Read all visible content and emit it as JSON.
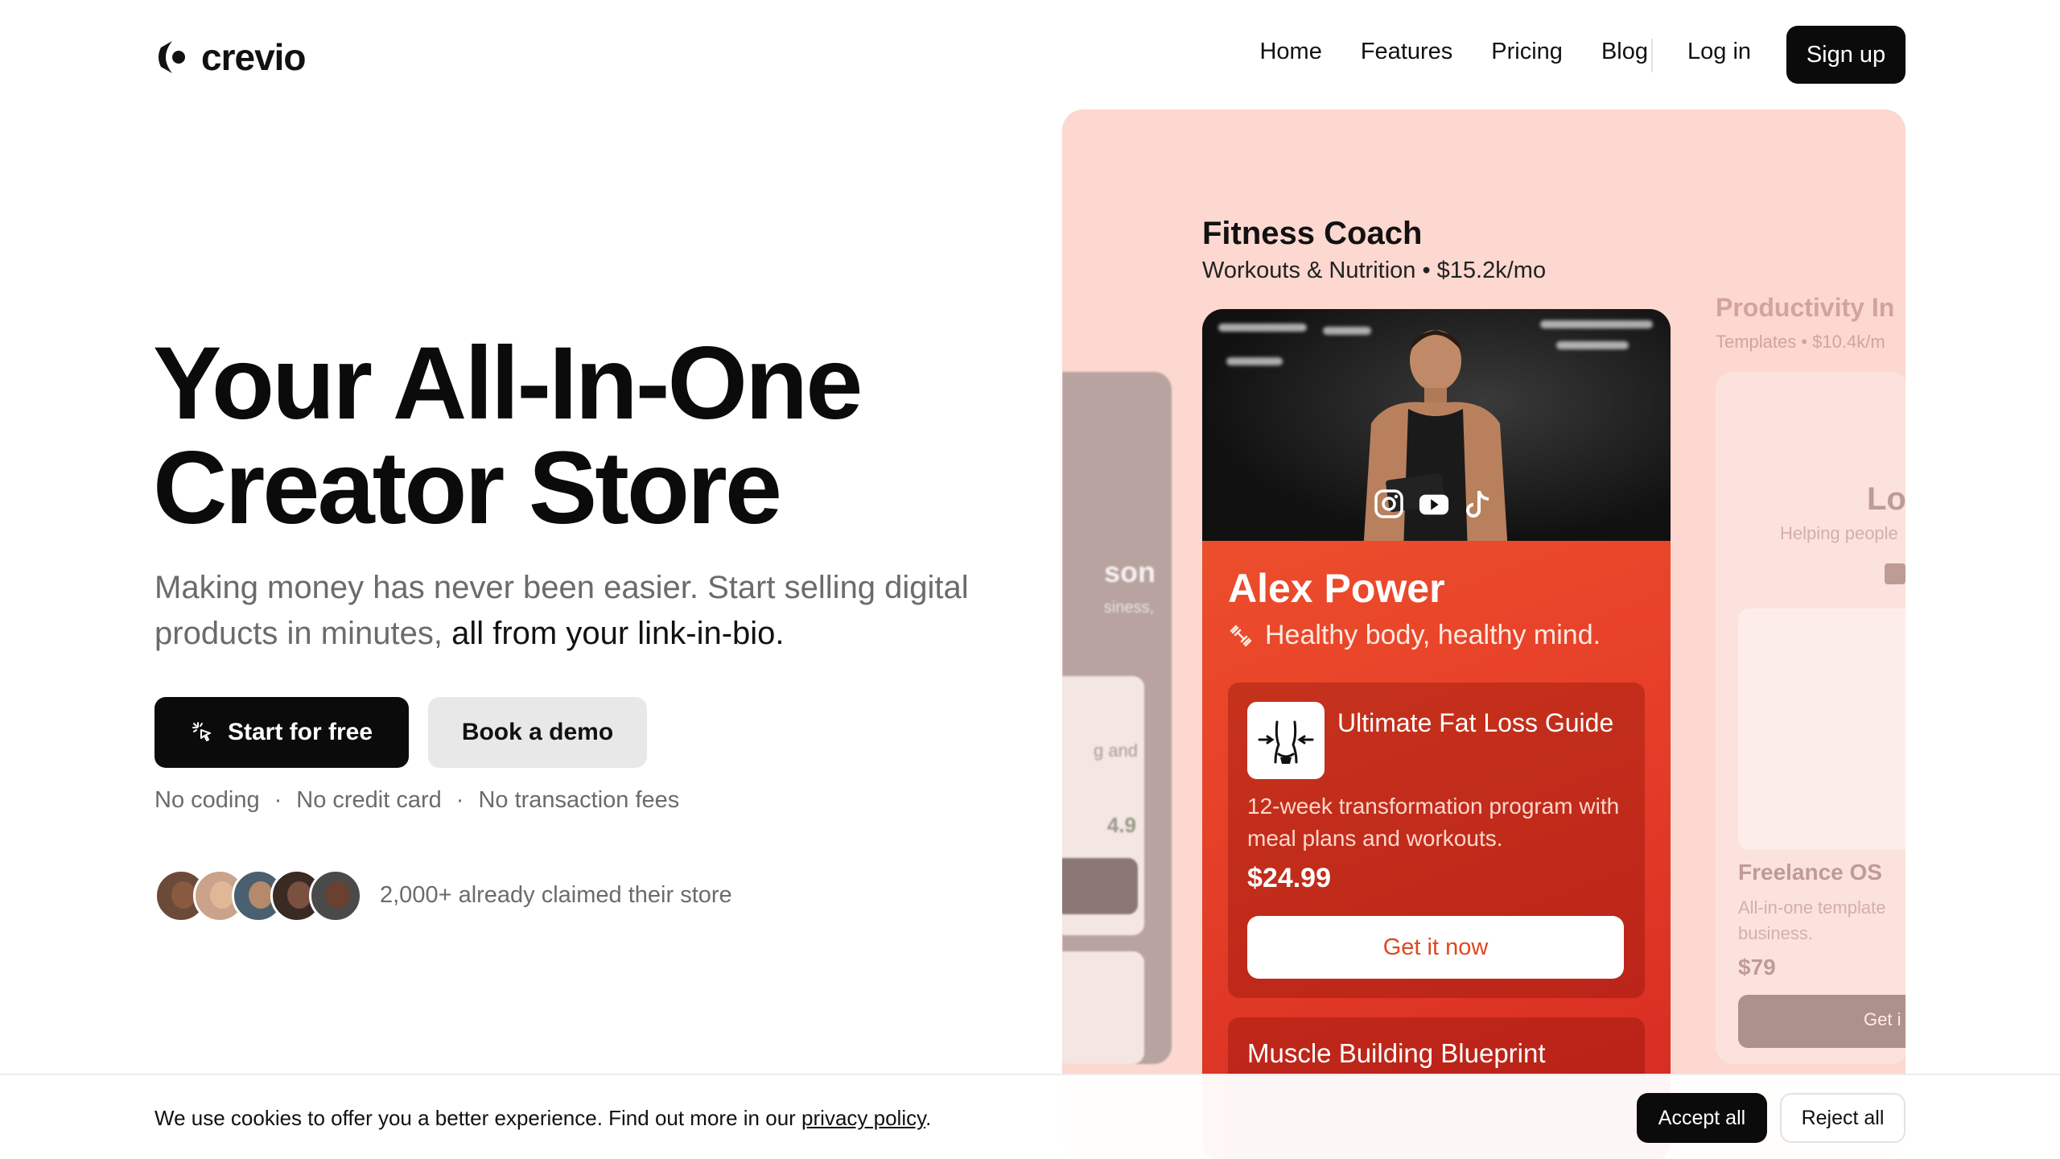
{
  "brand": {
    "name": "crevio"
  },
  "nav": {
    "links": [
      "Home",
      "Features",
      "Pricing",
      "Blog"
    ],
    "login": "Log in",
    "signup": "Sign up"
  },
  "hero": {
    "title_line1": "Your All-In-One",
    "title_line2": "Creator Store",
    "subtitle_muted": "Making money has never been easier. Start selling digital products in minutes,",
    "subtitle_strong": "all from your link-in-bio.",
    "cta_primary": "Start for free",
    "cta_secondary": "Book a demo",
    "perks": [
      "No coding",
      "No credit card",
      "No transaction fees"
    ],
    "perk_separator": "·",
    "social_proof": "2,000+ already claimed their store"
  },
  "showcase": {
    "left_ghost": {
      "title_fragment": "son",
      "sub_fragment": "siness,",
      "card_text": "g and",
      "rating": "4.9"
    },
    "right_ghost": {
      "title": "Productivity In",
      "subtitle": "Templates • $10.4k/m",
      "name_fragment": "Lo",
      "helper_fragment": "Helping people",
      "product_title": "Freelance OS",
      "product_desc": "All-in-one template business.",
      "price": "$79",
      "button": "Get i"
    },
    "coach": {
      "title": "Fitness Coach",
      "subtitle": "Workouts & Nutrition • $15.2k/mo",
      "name": "Alex Power",
      "tagline": "Healthy body, healthy mind.",
      "product": {
        "title": "Ultimate Fat Loss Guide",
        "description": "12-week transformation program with meal plans and workouts.",
        "price": "$24.99",
        "button": "Get it now"
      },
      "product2": {
        "title": "Muscle Building Blueprint"
      }
    }
  },
  "cookie": {
    "text": "We use cookies to offer you a better experience. Find out more in our",
    "link": "privacy policy",
    "end": ".",
    "accept": "Accept all",
    "reject": "Reject all"
  },
  "colors": {
    "accent": "#e8432a",
    "panel_bg": "#fcd8d0",
    "primary": "#0b0b0b"
  }
}
